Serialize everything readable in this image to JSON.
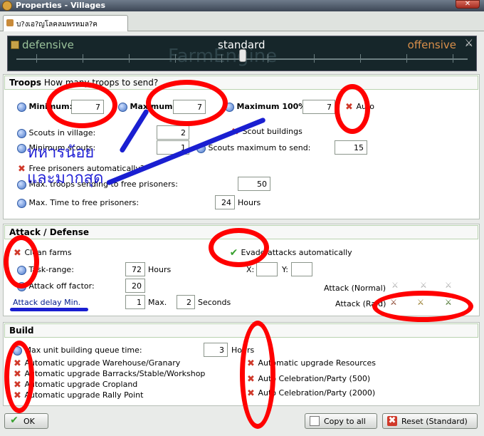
{
  "window": {
    "title": "Properties - Villages"
  },
  "tab": {
    "label": "บ?งเอ?ญโลคลมพรหมล?ค"
  },
  "strategy": {
    "defensive": "defensive",
    "standard": "standard",
    "offensive": "offensive",
    "watermark": "FarmEngine"
  },
  "troops": {
    "title": "Troops",
    "subtitle": "How many troops to send?",
    "minimum_label": "Minimum:",
    "minimum_value": "7",
    "maximum_label": "Maximum:",
    "maximum_value": "7",
    "max100_label": "Maximum 100%:",
    "max100_value": "7",
    "auto_label": "Auto",
    "scouts_in_village_label": "Scouts in village:",
    "scouts_in_village_value": "2",
    "scout_buildings_label": "Scout buildings",
    "minimum_scouts_label": "Minimum scouts:",
    "minimum_scouts_value": "1",
    "scouts_max_send_label": "Scouts maximum to send:",
    "scouts_max_send_value": "15",
    "free_prisoners_label": "Free prisoners automatically?",
    "max_troops_free_label": "Max. troops sending to free prisoners:",
    "max_troops_free_value": "50",
    "max_time_free_label": "Max. Time to free prisoners:",
    "max_time_free_value": "24",
    "hours": "Hours"
  },
  "attack": {
    "title": "Attack / Defense",
    "clean_farms_label": "Clean farms",
    "evade_label": "Evade attacks automatically",
    "task_range_label": "Task-range:",
    "task_range_value": "72",
    "hours": "Hours",
    "x_label": "X:",
    "y_label": "Y:",
    "attack_off_label": "Attack off factor:",
    "attack_off_value": "20",
    "attack_normal_label": "Attack (Normal)",
    "attack_raid_label": "Attack (Raid)",
    "delay_label": "Attack delay Min.",
    "delay_min_value": "1",
    "max_label": "Max.",
    "delay_max_value": "2",
    "seconds": "Seconds"
  },
  "build": {
    "title": "Build",
    "queue_label": "Max unit building queue time:",
    "queue_value": "3",
    "hours": "Hours",
    "warehouse_label": "Automatic upgrade Warehouse/Granary",
    "barracks_label": "Automatic upgrade Barracks/Stable/Workshop",
    "cropland_label": "Automatic upgrade Cropland",
    "rally_label": "Automatic upgrade Rally Point",
    "resources_label": "Automatic upgrade Resources",
    "party500_label": "Auto Celebration/Party (500)",
    "party2000_label": "Auto Celebration/Party (2000)"
  },
  "buttons": {
    "ok": "OK",
    "copy": "Copy to all",
    "reset": "Reset (Standard)"
  },
  "annotations": {
    "thai_line1": "ทหารน้อย",
    "thai_line2": "และมากสุด"
  },
  "colors": {
    "annotation_red": "#ff0000",
    "annotation_blue": "#1a1fd1"
  }
}
